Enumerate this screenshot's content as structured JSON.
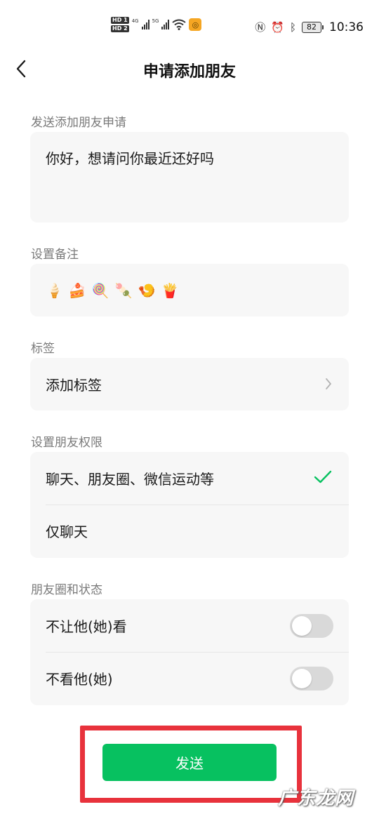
{
  "status_bar": {
    "hd1": "HD 1",
    "hd2": "HD 2",
    "net_4g": "4G",
    "net_5g": "5G",
    "battery": "82",
    "time": "10:36"
  },
  "nav": {
    "title": "申请添加朋友"
  },
  "request": {
    "label": "发送添加朋友申请",
    "message": "你好，想请问你最近还好吗"
  },
  "remark": {
    "label": "设置备注",
    "emojis": [
      "🍦",
      "🍰",
      "🍭",
      "🍡",
      "🍤",
      "🍟"
    ]
  },
  "tags": {
    "label": "标签",
    "add_label": "添加标签"
  },
  "permissions": {
    "label": "设置朋友权限",
    "options": [
      {
        "label": "聊天、朋友圈、微信运动等",
        "selected": true
      },
      {
        "label": "仅聊天",
        "selected": false
      }
    ],
    "check_color": "#07c160"
  },
  "moments": {
    "label": "朋友圈和状态",
    "dont_let_see": {
      "label": "不让他(她)看",
      "on": false
    },
    "dont_see": {
      "label": "不看他(她)",
      "on": false
    }
  },
  "send": {
    "label": "发送",
    "color": "#07c160",
    "highlight_color": "#e8323c"
  },
  "watermark": "广东龙网"
}
